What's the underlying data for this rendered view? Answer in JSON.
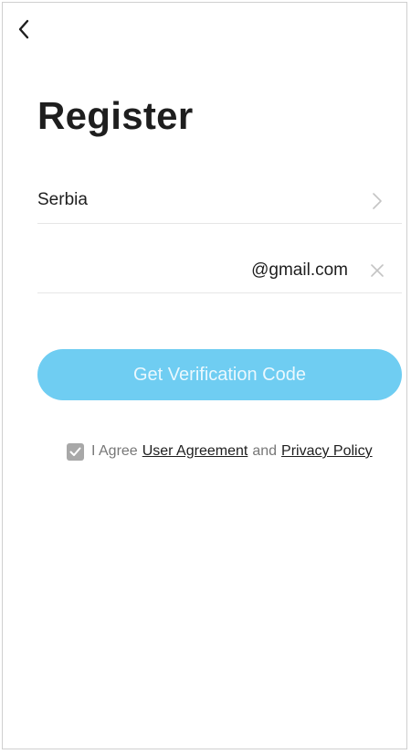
{
  "header": {
    "back_icon": "chevron-left-icon",
    "title": "Register"
  },
  "form": {
    "country": {
      "value": "Serbia",
      "icon": "chevron-right-icon"
    },
    "email": {
      "value": "@gmail.com",
      "clear_icon": "close-icon"
    },
    "submit_label": "Get Verification Code",
    "submit_color": "#6fcdf2"
  },
  "agreement": {
    "checked": true,
    "prefix": "I Agree",
    "user_agreement_link": "User Agreement",
    "conjunction": "and",
    "privacy_policy_link": "Privacy Policy"
  }
}
